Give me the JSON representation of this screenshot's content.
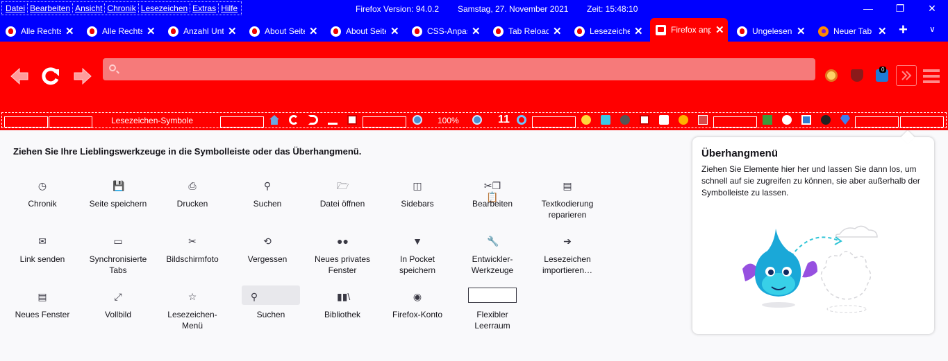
{
  "titlebar": {
    "menu": [
      "Datei",
      "Bearbeiten",
      "Ansicht",
      "Chronik",
      "Lesezeichen",
      "Extras",
      "Hilfe"
    ],
    "version": "Firefox Version: 94.0.2",
    "date": "Samstag, 27. November 2021",
    "time": "Zeit:  15:48:10",
    "controls": {
      "minimize": "—",
      "restore": "❐",
      "close": "✕"
    }
  },
  "tabs": [
    {
      "label": "Alle Rechts",
      "icon": "red-logo-icon"
    },
    {
      "label": "Alle Rechts",
      "icon": "red-logo-icon"
    },
    {
      "label": "Anzahl Unt",
      "icon": "red-logo-icon"
    },
    {
      "label": "About Seite",
      "icon": "red-logo-icon"
    },
    {
      "label": "About Seite",
      "icon": "red-logo-icon"
    },
    {
      "label": "CSS-Anpas",
      "icon": "red-logo-icon"
    },
    {
      "label": "Tab Reload",
      "icon": "red-logo-icon"
    },
    {
      "label": "Lesezeiche",
      "icon": "red-logo-icon"
    },
    {
      "label": "Firefox anp",
      "icon": "pin-icon",
      "active": true
    },
    {
      "label": "Ungelesen",
      "icon": "red-logo-icon"
    },
    {
      "label": "Neuer Tab",
      "icon": "firefox-icon"
    }
  ],
  "tabclose": "✕",
  "newtab": "+",
  "tablist": "∨",
  "navbar": {
    "url_placeholder": "",
    "extensions": [
      "duckduckgo-icon",
      "ublock-icon",
      "extension-icon"
    ],
    "badge": "0"
  },
  "bookmarks": {
    "label": "Lesezeichen-Symbole",
    "zoom": "100%",
    "count": "11"
  },
  "customize": {
    "intro": "Ziehen Sie Ihre Lieblingswerkzeuge in die Symbolleiste oder das Überhangmenü.",
    "items": [
      {
        "label": "Chronik",
        "icon": "clock-icon"
      },
      {
        "label": "Seite speichern",
        "icon": "save-page-icon"
      },
      {
        "label": "Drucken",
        "icon": "printer-icon"
      },
      {
        "label": "Suchen",
        "icon": "search-icon"
      },
      {
        "label": "Datei öffnen",
        "icon": "open-file-icon"
      },
      {
        "label": "Sidebars",
        "icon": "sidebar-icon"
      },
      {
        "label": "Bearbeiten",
        "icon": "edit-icon"
      },
      {
        "label": "Textkodierung reparieren",
        "icon": "text-encoding-icon"
      },
      {
        "label": "Link senden",
        "icon": "mail-icon"
      },
      {
        "label": "Synchronisierte Tabs",
        "icon": "synced-tabs-icon"
      },
      {
        "label": "Bildschirmfoto",
        "icon": "screenshot-icon"
      },
      {
        "label": "Vergessen",
        "icon": "forget-icon"
      },
      {
        "label": "Neues privates Fenster",
        "icon": "private-mask-icon"
      },
      {
        "label": "In Pocket speichern",
        "icon": "pocket-icon"
      },
      {
        "label": "Entwickler-Werkzeuge",
        "icon": "wrench-icon"
      },
      {
        "label": "Lesezeichen importieren…",
        "icon": "import-icon"
      },
      {
        "label": "Neues Fenster",
        "icon": "new-window-icon"
      },
      {
        "label": "Vollbild",
        "icon": "fullscreen-icon"
      },
      {
        "label": "Lesezeichen-Menü",
        "icon": "bookmark-menu-icon"
      },
      {
        "label": "Suchen",
        "icon": "search-icon"
      },
      {
        "label": "Bibliothek",
        "icon": "library-icon"
      },
      {
        "label": "Firefox-Konto",
        "icon": "account-icon"
      },
      {
        "label": "Flexibler Leerraum",
        "icon": "flexible-space"
      }
    ]
  },
  "overflow_panel": {
    "title": "Überhangmenü",
    "text": "Ziehen Sie Elemente hier her und lassen Sie dann los, um schnell auf sie zugreifen zu können, sie aber außerhalb der Symbolleiste zu lassen."
  },
  "colors": {
    "chrome": "#0000ff",
    "toolbar": "#ff0000",
    "urlbar": "#f67a7a",
    "content": "#f9f9fb"
  }
}
